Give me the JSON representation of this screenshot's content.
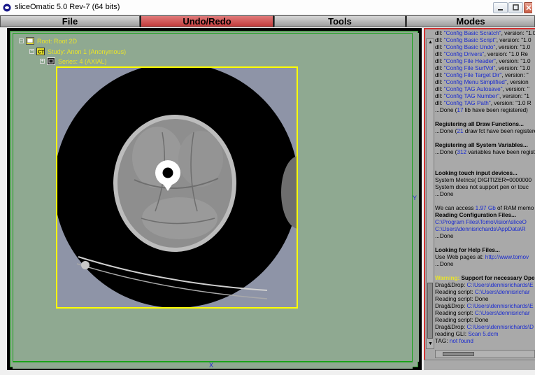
{
  "window": {
    "title": "sliceOmatic 5.0 Rev-7 (64 bits)",
    "buttons": [
      "minimize-icon",
      "maximize-icon",
      "close-icon"
    ]
  },
  "menu": {
    "items": [
      {
        "label": "File"
      },
      {
        "label": "Undo/Redo",
        "active": true
      },
      {
        "label": "Tools"
      },
      {
        "label": "Modes"
      }
    ]
  },
  "viewer": {
    "tree": {
      "root": "Root: Root 2D",
      "study": "Study: Anon 1 (Anonymous)",
      "series": "Series: 4 (AXIAL)"
    },
    "axis_y": "Y",
    "axis_x": "X",
    "colors": {
      "background": "#8fa991",
      "frame": "#ffff00",
      "border": "#1aa31a"
    }
  },
  "log": {
    "lines": [
      {
        "pre": "   dll: ",
        "link": "\"Config Basic Scratch\"",
        "post": ", version: \"1.0"
      },
      {
        "pre": "   dll: ",
        "link": "\"Config Basic Script\"",
        "post": ", version: \"1.0"
      },
      {
        "pre": "   dll: ",
        "link": "\"Config Basic Undo\"",
        "post": ", version: \"1.0"
      },
      {
        "pre": "   dll: ",
        "link": "\"Config Drivers\"",
        "post": ", version: \"1.0 Re"
      },
      {
        "pre": "   dll: ",
        "link": "\"Config File Header\"",
        "post": ", version: \"1.0"
      },
      {
        "pre": "   dll: ",
        "link": "\"Config File SurfVol\"",
        "post": ", version: \"1.0"
      },
      {
        "pre": "   dll: ",
        "link": "\"Config File Target Dir\"",
        "post": ", version: \""
      },
      {
        "pre": "   dll: ",
        "link": "\"Config Menu Simplified\"",
        "post": ", version"
      },
      {
        "pre": "   dll: ",
        "link": "\"Config TAG Autosave\"",
        "post": ", version: \""
      },
      {
        "pre": "   dll: ",
        "link": "\"Config TAG Number\"",
        "post": ", version: \"1"
      },
      {
        "pre": "   dll: ",
        "link": "\"Config TAG Path\"",
        "post": ", version: \"1.0 R"
      },
      {
        "pre": "...Done (",
        "link": "17",
        "post": " lib have been registered)"
      },
      {
        "pre": "",
        "link": "",
        "post": ""
      },
      {
        "pre": "Registering all Draw Functions...",
        "link": "",
        "post": "",
        "bold": true
      },
      {
        "pre": "...Done (",
        "link": "21",
        "post": " draw fct have been registere"
      },
      {
        "pre": "",
        "link": "",
        "post": ""
      },
      {
        "pre": "Registering all System Variables...",
        "link": "",
        "post": "",
        "bold": true
      },
      {
        "pre": "...Done (",
        "link": "312",
        "post": " variables have been regist"
      },
      {
        "pre": "",
        "link": "",
        "post": ""
      },
      {
        "pre": "",
        "link": "",
        "post": ""
      },
      {
        "pre": "Looking touch input devices...",
        "link": "",
        "post": "",
        "bold": true
      },
      {
        "pre": "   System Metrics( DIGITIZER=0000000",
        "link": "",
        "post": ""
      },
      {
        "pre": "   System does not support pen or touc",
        "link": "",
        "post": ""
      },
      {
        "pre": "...Done",
        "link": "",
        "post": ""
      },
      {
        "pre": "",
        "link": "",
        "post": ""
      },
      {
        "pre": "We can access ",
        "link": "1.97 Gb",
        "post": " of RAM memo"
      },
      {
        "pre": "Reading Configuration Files...",
        "link": "",
        "post": "",
        "bold": true
      },
      {
        "pre": "   ",
        "link": "C:\\Program Files\\TomoVision\\sliceO",
        "post": ""
      },
      {
        "pre": "   ",
        "link": "C:\\Users\\dennisrichards\\AppData\\R",
        "post": ""
      },
      {
        "pre": "...Done",
        "link": "",
        "post": ""
      },
      {
        "pre": "",
        "link": "",
        "post": ""
      },
      {
        "pre": "Looking for Help Files...",
        "link": "",
        "post": "",
        "bold": true
      },
      {
        "pre": "   Use Web pages at: ",
        "link": "http://www.tomov",
        "post": ""
      },
      {
        "pre": "...Done",
        "link": "",
        "post": ""
      },
      {
        "pre": "",
        "link": "",
        "post": ""
      },
      {
        "pre": "",
        "link": "",
        "post": "",
        "warn": "Warning:",
        "warnpost": " Support for necessary Oper"
      },
      {
        "pre": "Drag&Drop: ",
        "link": "C:\\Users\\dennisrichards\\E",
        "post": ""
      },
      {
        "pre": "Reading script: ",
        "link": "C:\\Users\\dennisrichar",
        "post": ""
      },
      {
        "pre": "Reading script: Done",
        "link": "",
        "post": ""
      },
      {
        "pre": "Drag&Drop: ",
        "link": "C:\\Users\\dennisrichards\\E",
        "post": ""
      },
      {
        "pre": "Reading script: ",
        "link": "C:\\Users\\dennisrichar",
        "post": ""
      },
      {
        "pre": "Reading script: Done",
        "link": "",
        "post": ""
      },
      {
        "pre": "Drag&Drop: ",
        "link": "C:\\Users\\dennisrichards\\D",
        "post": ""
      },
      {
        "pre": "reading   GLI:   ",
        "link": "Scan 5.dcm",
        "post": ""
      },
      {
        "pre": "               TAG:   ",
        "link": "not found",
        "post": ""
      }
    ]
  }
}
